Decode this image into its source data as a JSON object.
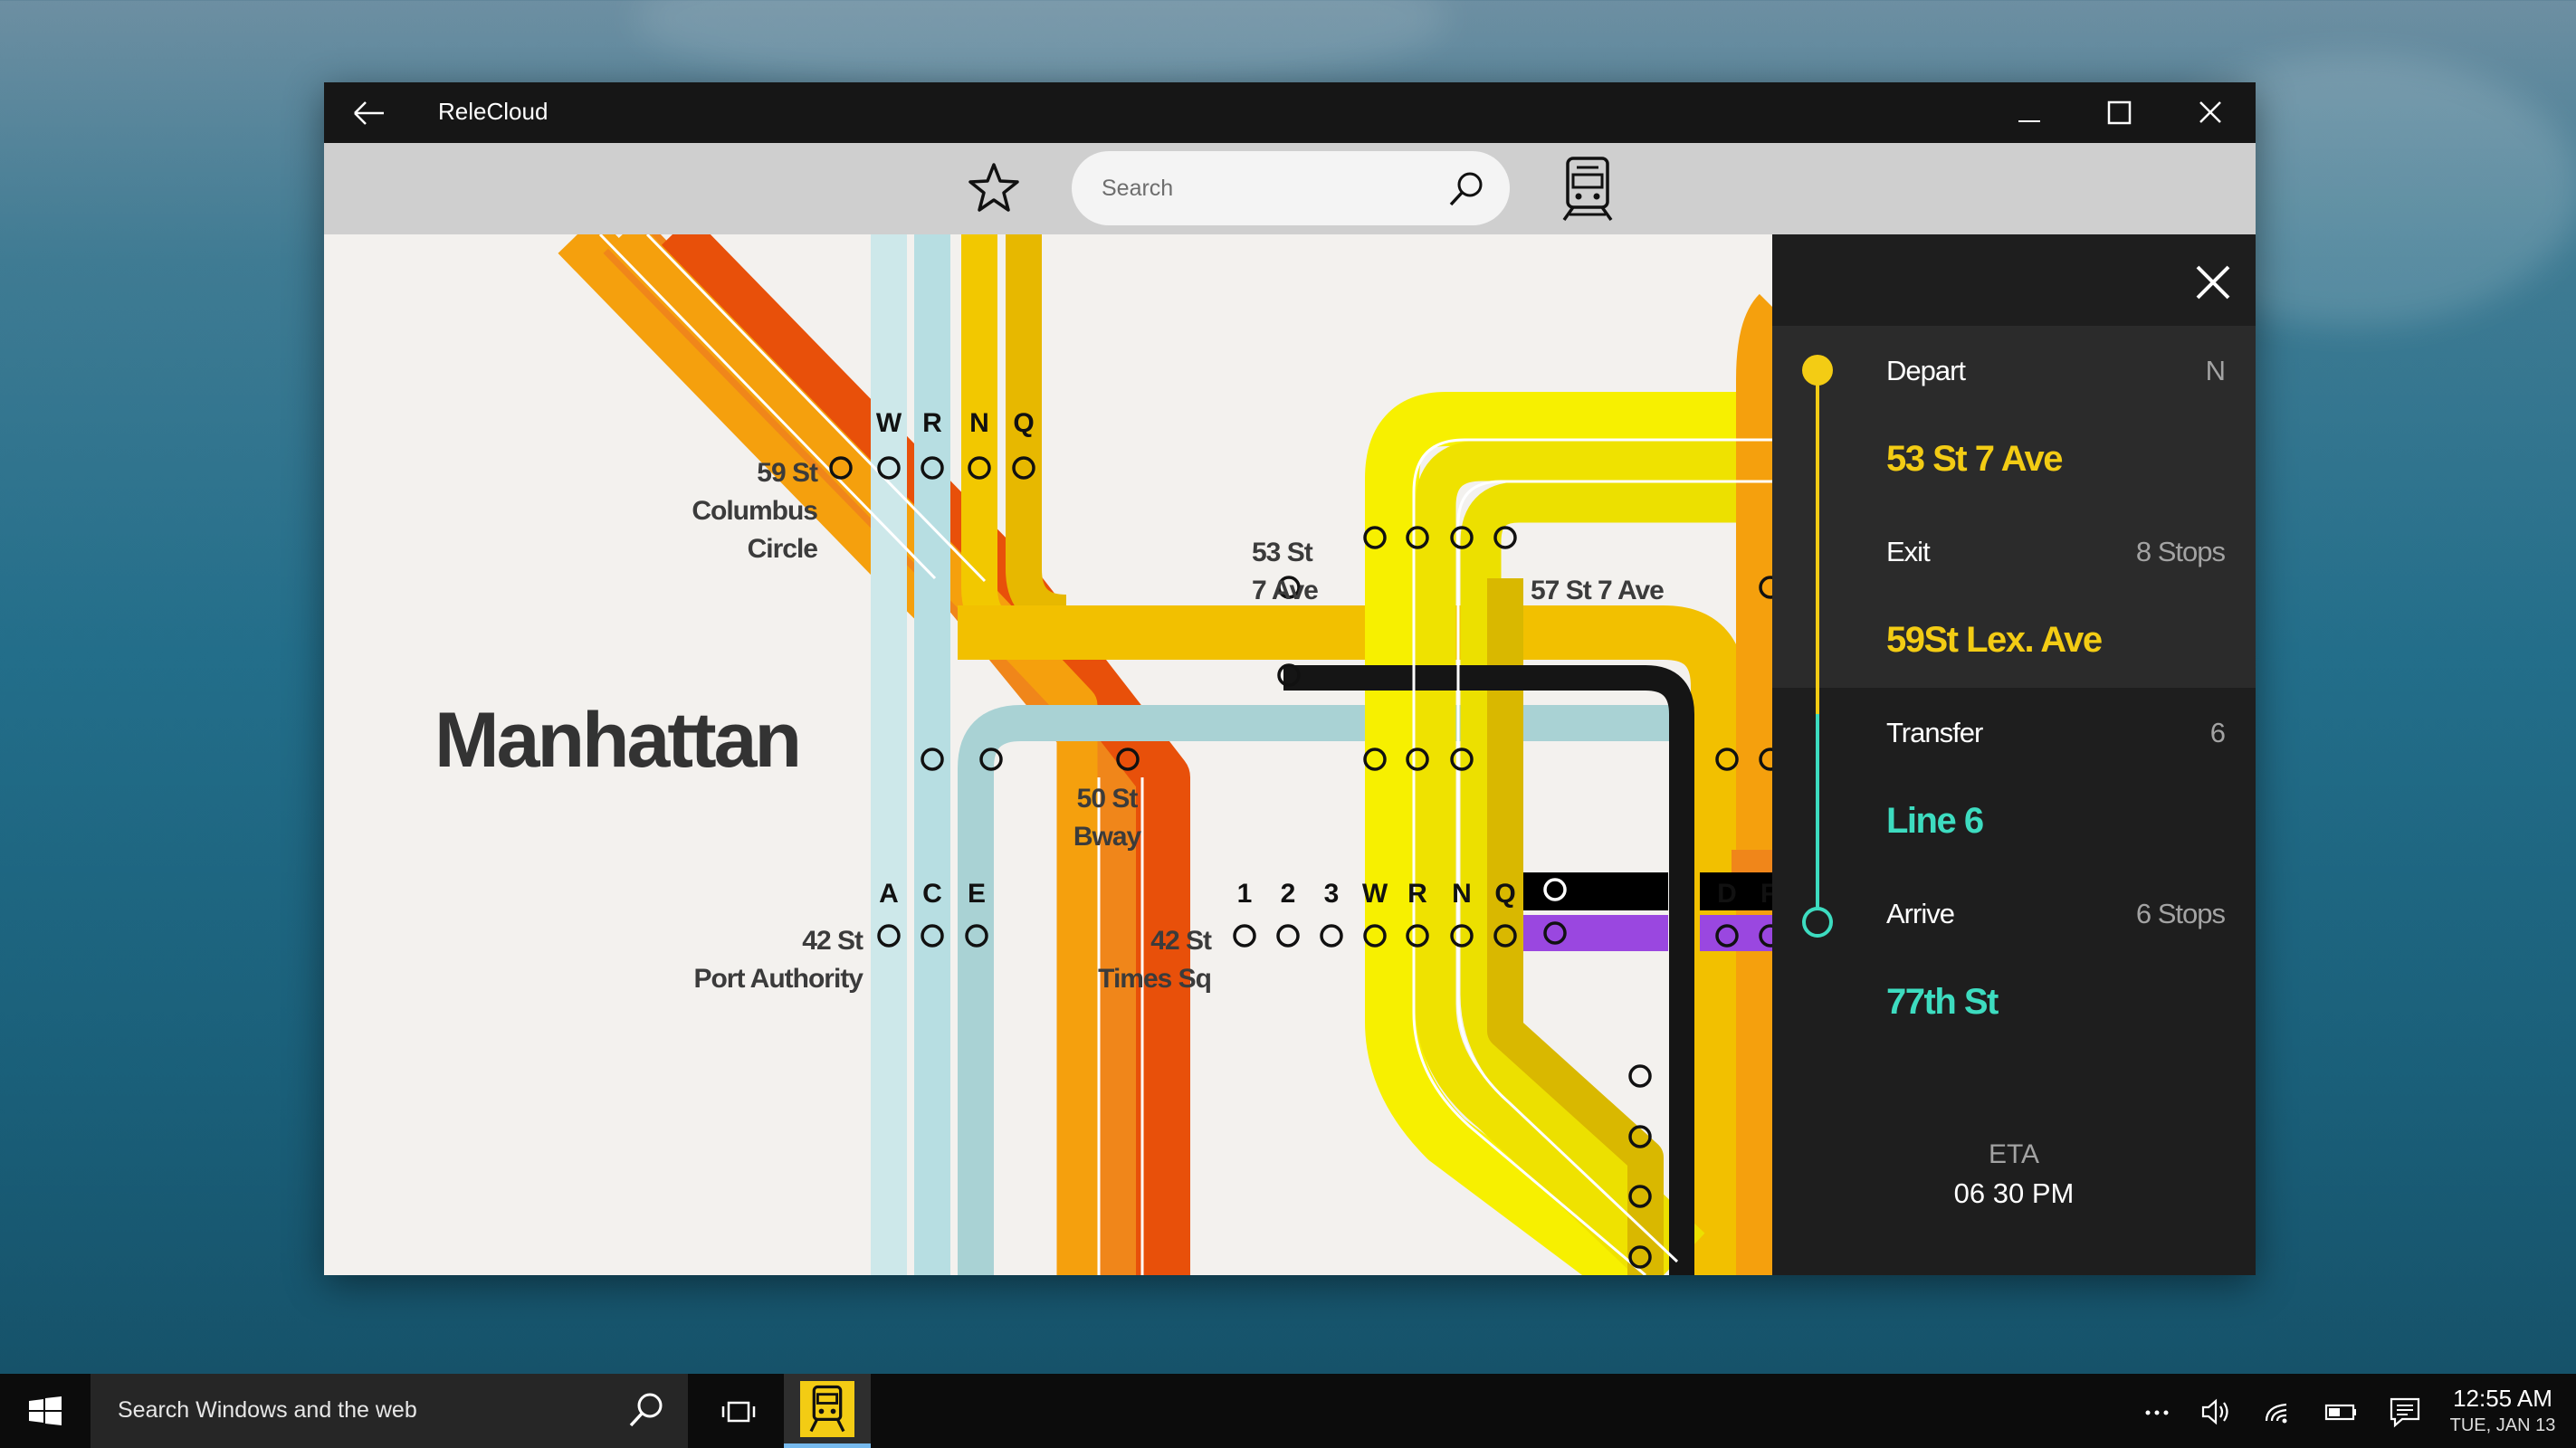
{
  "window": {
    "title": "ReleCloud"
  },
  "toolbar": {
    "search_placeholder": "Search"
  },
  "map": {
    "borough": "Manhattan",
    "stations": {
      "columbus_l1": "59 St",
      "columbus_l2": "Columbus",
      "columbus_l3": "Circle",
      "st53_l1": "53 St",
      "st53_l2": "7 Ave",
      "st57": "57 St 7 Ave",
      "st50_l1": "50 St",
      "st50_l2": "Bway",
      "portauth_l1": "42 St",
      "portauth_l2": "Port Authority",
      "timessq_l1": "42 St",
      "timessq_l2": "Times Sq"
    },
    "line_letters": {
      "top": [
        "W",
        "R",
        "N",
        "Q"
      ],
      "ace": [
        "A",
        "C",
        "E"
      ],
      "nums": [
        "1",
        "2",
        "3"
      ],
      "wrnq": [
        "W",
        "R",
        "N",
        "Q"
      ],
      "df": [
        "D",
        "F"
      ]
    }
  },
  "route": {
    "depart": {
      "label": "Depart",
      "line": "N",
      "station": "53 St 7 Ave"
    },
    "exit": {
      "label": "Exit",
      "stops": "8 Stops",
      "station": "59St Lex. Ave"
    },
    "transfer": {
      "label": "Transfer",
      "line": "6",
      "line_name": "Line 6"
    },
    "arrive": {
      "label": "Arrive",
      "stops": "6 Stops",
      "station": "77th St"
    },
    "eta_label": "ETA",
    "eta_value": "06 30 PM"
  },
  "colors": {
    "depart_accent": "#f3cc14",
    "arrive_accent": "#3ddcc0"
  },
  "taskbar": {
    "search_text": "Search Windows and the web",
    "time": "12:55 AM",
    "date": "TUE, JAN 13"
  }
}
